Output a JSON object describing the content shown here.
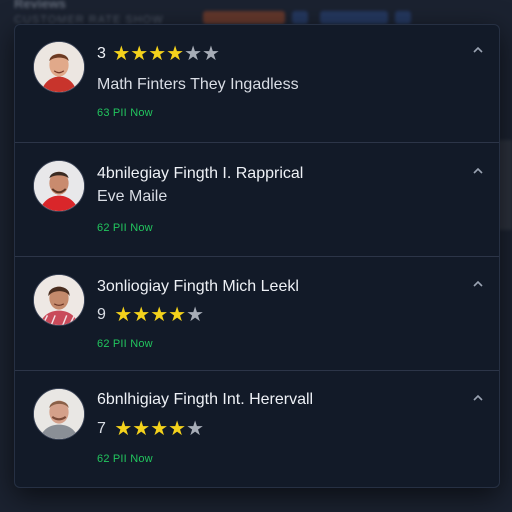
{
  "background": {
    "title": "Reviews",
    "subtitle": "CUSTOMER RATE SHOW"
  },
  "colors": {
    "panel_bg": "#121a28",
    "star_filled": "#f4d21c",
    "star_empty": "#a7adb7",
    "timestamp": "#22c55e"
  },
  "reviews": [
    {
      "rating_number": "3",
      "rating": 4,
      "max_rating": 5,
      "text": "Math Finters They Ingadless",
      "time": "63 PII Now",
      "avatar_icon": "user-avatar-icon",
      "collapse_icon": "chevron-up-icon"
    },
    {
      "line1": "4bnilegiay Fingth I. Rapprical",
      "line2": "Eve Maile",
      "time": "62 PII Now",
      "avatar_icon": "user-avatar-icon",
      "collapse_icon": "chevron-up-icon"
    },
    {
      "line1": "3onliogiay Fingth Mich Leekl",
      "rating_number": "9",
      "rating": 4,
      "max_rating": 5,
      "time": "62 PII Now",
      "avatar_icon": "user-avatar-icon",
      "collapse_icon": "chevron-up-icon"
    },
    {
      "line1": "6bnlhigiay Fingth Int. Herervall",
      "rating_number": "7",
      "rating": 4,
      "max_rating": 5,
      "time": "62 PII Now",
      "avatar_icon": "user-avatar-icon",
      "collapse_icon": "chevron-up-icon"
    }
  ]
}
